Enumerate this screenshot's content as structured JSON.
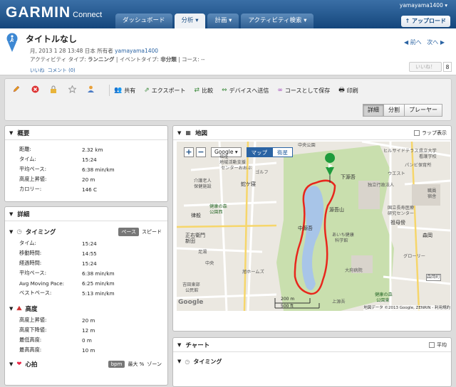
{
  "app": {
    "logo_main": "GARMIN",
    "logo_sub": "Connect",
    "user": "yamayama1400 ▾",
    "upload_label": "↑ アップロード"
  },
  "nav": {
    "tabs": [
      {
        "label": "ダッシュボード"
      },
      {
        "label": "分析 ▾"
      },
      {
        "label": "計画 ▾"
      },
      {
        "label": "アクティビティ検索 ▾"
      }
    ]
  },
  "activity": {
    "title": "タイトルなし",
    "meta_date": "月, 2013 1 28 13:48 日本 所有者",
    "owner": "yamayama1400",
    "meta_type_prefix": "アクティビティ タイプ:",
    "type": "ランニング",
    "meta_event_prefix": "| イベントタイプ:",
    "event_type": "非分類",
    "meta_course": "| コース: --",
    "like_link": "いいね",
    "comment_link": "コメント (0)",
    "prev": "◀ 前へ",
    "next": "次へ ▶",
    "like_button": "いいね！",
    "like_count": "8"
  },
  "toolbar": {
    "actions": [
      {
        "icon": "share-icon",
        "label": "共有"
      },
      {
        "icon": "export-icon",
        "label": "エクスポート"
      },
      {
        "icon": "compare-icon",
        "label": "比較"
      },
      {
        "icon": "device-icon",
        "label": "デバイスへ送信"
      },
      {
        "icon": "course-icon",
        "label": "コースとして保存"
      },
      {
        "icon": "print-icon",
        "label": "印刷"
      }
    ],
    "views": [
      {
        "label": "詳細"
      },
      {
        "label": "分割"
      },
      {
        "label": "プレーヤー"
      }
    ]
  },
  "overview": {
    "title": "概要",
    "rows": [
      {
        "k": "距離:",
        "v": "2.32 km"
      },
      {
        "k": "タイム:",
        "v": "15:24"
      },
      {
        "k": "平均ペース:",
        "v": "6:38 min/km"
      },
      {
        "k": "高度上昇値:",
        "v": "20 m"
      },
      {
        "k": "カロリー:",
        "v": "146 C"
      }
    ]
  },
  "details": {
    "title": "詳細",
    "timing": {
      "title": "タイミング",
      "opt_on": "ペース",
      "opt_off": "スピード",
      "rows": [
        {
          "k": "タイム:",
          "v": "15:24"
        },
        {
          "k": "移動時間:",
          "v": "14:55"
        },
        {
          "k": "経過時間:",
          "v": "15:24"
        },
        {
          "k": "平均ペース:",
          "v": "6:38 min/km"
        },
        {
          "k": "Avg Moving Pace:",
          "v": "6:25 min/km"
        },
        {
          "k": "ベストペース:",
          "v": "5:13 min/km"
        }
      ]
    },
    "elevation": {
      "title": "高度",
      "rows": [
        {
          "k": "高度上昇値:",
          "v": "20 m"
        },
        {
          "k": "高度下降値:",
          "v": "12 m"
        },
        {
          "k": "最低高度:",
          "v": "0 m"
        },
        {
          "k": "最高高度:",
          "v": "10 m"
        }
      ]
    },
    "heart": {
      "title": "心拍",
      "opt_on": "bpm",
      "opt_mid": "最大 %",
      "opt_off": "ゾーン"
    }
  },
  "map": {
    "title": "地図",
    "lap_label": "ラップ表示",
    "provider": "Google ▾",
    "type_map": "マップ",
    "type_sat": "衛星",
    "scale_m": "200 m",
    "scale_ft": "500 ft",
    "copyright": "地図データ ©2013 Google, ZENRIN - 利用規約",
    "google_logo": "Google",
    "labels": [
      {
        "t": "中央公園"
      },
      {
        "t": "ヒルサイドテラス"
      },
      {
        "t": "県立大学"
      },
      {
        "t": "看護学校"
      },
      {
        "t": "地域活動支援"
      },
      {
        "t": "センターおおぶ"
      },
      {
        "t": "介護老人"
      },
      {
        "t": "保健施設"
      },
      {
        "t": "蛇ケ寝"
      },
      {
        "t": "健康の森"
      },
      {
        "t": "公園西"
      },
      {
        "t": "下源吾"
      },
      {
        "t": "パンビ保育所"
      },
      {
        "t": "独立行政法人"
      },
      {
        "t": "国立長寿医療"
      },
      {
        "t": "研究センター"
      },
      {
        "t": "源吾山"
      },
      {
        "t": "中源吾"
      },
      {
        "t": "あいち健康"
      },
      {
        "t": "科学館"
      },
      {
        "t": "大府病院"
      },
      {
        "t": "旭ホームズ"
      },
      {
        "t": "正右衛門新田"
      },
      {
        "t": "律般"
      },
      {
        "t": "足湯"
      },
      {
        "t": "祖母傍"
      },
      {
        "t": "森岡"
      },
      {
        "t": "グローリー"
      },
      {
        "t": "健康の森"
      },
      {
        "t": "公園東"
      },
      {
        "t": "上源吾"
      },
      {
        "t": "森岡町"
      },
      {
        "t": "吉田東部"
      },
      {
        "t": "公民館"
      },
      {
        "t": "ゴルフ"
      },
      {
        "t": "福祉"
      },
      {
        "t": "中央"
      },
      {
        "t": "職員"
      },
      {
        "t": "宿舎"
      },
      {
        "t": "ウエスト"
      }
    ]
  },
  "chart": {
    "title": "チャート",
    "avg_label": "平均",
    "sub_title": "タイミング"
  },
  "colors": {
    "route": "#e8261c",
    "park": "#c9dfae",
    "water": "#a8c5e8",
    "header_blue": "#1b4f85"
  }
}
